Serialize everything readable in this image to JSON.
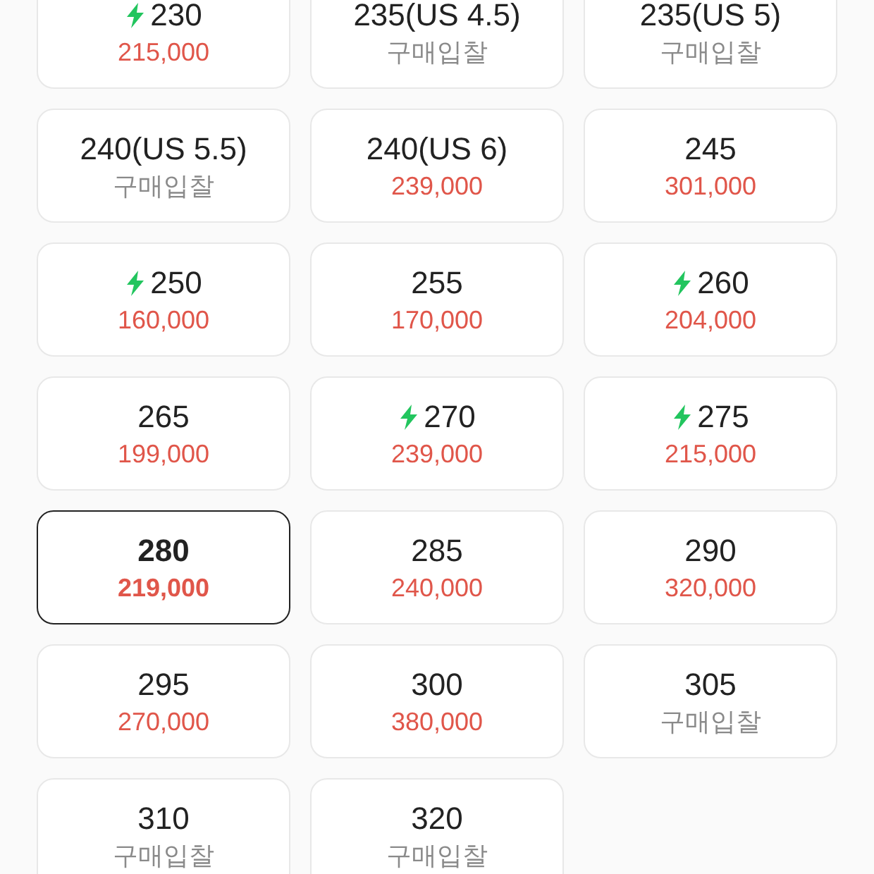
{
  "sizes": [
    {
      "size": "230",
      "fast": true,
      "kind": "price",
      "price": "215,000",
      "selected": false
    },
    {
      "size": "235(US 4.5)",
      "fast": false,
      "kind": "bid",
      "price": "구매입찰",
      "selected": false
    },
    {
      "size": "235(US 5)",
      "fast": false,
      "kind": "bid",
      "price": "구매입찰",
      "selected": false
    },
    {
      "size": "240(US 5.5)",
      "fast": false,
      "kind": "bid",
      "price": "구매입찰",
      "selected": false
    },
    {
      "size": "240(US 6)",
      "fast": false,
      "kind": "price",
      "price": "239,000",
      "selected": false
    },
    {
      "size": "245",
      "fast": false,
      "kind": "price",
      "price": "301,000",
      "selected": false
    },
    {
      "size": "250",
      "fast": true,
      "kind": "price",
      "price": "160,000",
      "selected": false
    },
    {
      "size": "255",
      "fast": false,
      "kind": "price",
      "price": "170,000",
      "selected": false
    },
    {
      "size": "260",
      "fast": true,
      "kind": "price",
      "price": "204,000",
      "selected": false
    },
    {
      "size": "265",
      "fast": false,
      "kind": "price",
      "price": "199,000",
      "selected": false
    },
    {
      "size": "270",
      "fast": true,
      "kind": "price",
      "price": "239,000",
      "selected": false
    },
    {
      "size": "275",
      "fast": true,
      "kind": "price",
      "price": "215,000",
      "selected": false
    },
    {
      "size": "280",
      "fast": false,
      "kind": "price",
      "price": "219,000",
      "selected": true
    },
    {
      "size": "285",
      "fast": false,
      "kind": "price",
      "price": "240,000",
      "selected": false
    },
    {
      "size": "290",
      "fast": false,
      "kind": "price",
      "price": "320,000",
      "selected": false
    },
    {
      "size": "295",
      "fast": false,
      "kind": "price",
      "price": "270,000",
      "selected": false
    },
    {
      "size": "300",
      "fast": false,
      "kind": "price",
      "price": "380,000",
      "selected": false
    },
    {
      "size": "305",
      "fast": false,
      "kind": "bid",
      "price": "구매입찰",
      "selected": false
    },
    {
      "size": "310",
      "fast": false,
      "kind": "bid",
      "price": "구매입찰",
      "selected": false
    },
    {
      "size": "320",
      "fast": false,
      "kind": "bid",
      "price": "구매입찰",
      "selected": false
    }
  ]
}
